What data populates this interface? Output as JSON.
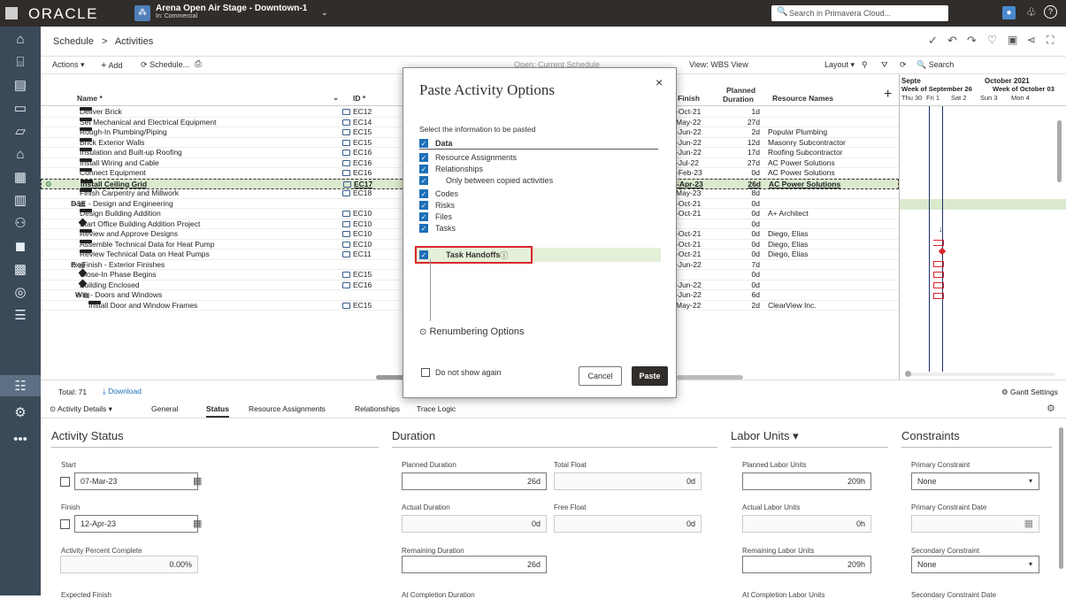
{
  "topbar": {
    "brand": "ORACLE",
    "project_name": "Arena Open Air Stage - Downtown-1",
    "project_sub": "In: Commercial",
    "search_placeholder": "Search in Primavera Cloud..."
  },
  "breadcrumb": {
    "root": "Schedule",
    "sep": ">",
    "current": "Activities"
  },
  "toolbar": {
    "actions": "Actions ▾",
    "add": "Add",
    "schedule": "Schedule...",
    "open_label": "Open: Current Schedule",
    "view": "View: WBS View",
    "layout": "Layout ▾",
    "search": "Search"
  },
  "grid": {
    "headers": {
      "name": "Name *",
      "id": "ID *",
      "finish": "Finish",
      "planned_duration_1": "Planned",
      "planned_duration_2": "Duration",
      "resources": "Resource Names"
    },
    "rows": [
      {
        "name": "Deliver Brick",
        "indent": 2,
        "type": "bar",
        "id": "EC12",
        "finish": "-Oct-21",
        "dur": "1d",
        "res": "",
        "note": true
      },
      {
        "name": "Set Mechanical and Electrical Equipment",
        "indent": 2,
        "type": "bar",
        "id": "EC14",
        "finish": "May-22",
        "dur": "27d",
        "res": "",
        "note": true
      },
      {
        "name": "Rough-In Plumbing/Piping",
        "indent": 2,
        "type": "bar",
        "id": "EC15",
        "finish": "-Jun-22",
        "dur": "2d",
        "res": "Popular Plumbing",
        "note": true
      },
      {
        "name": "Brick Exterior Walls",
        "indent": 2,
        "type": "bar",
        "id": "EC15",
        "finish": "-Jun-22",
        "dur": "12d",
        "res": "Masonry Subcontractor",
        "note": true
      },
      {
        "name": "Insulation and Built-up Roofing",
        "indent": 2,
        "type": "bar",
        "id": "EC16",
        "finish": "-Jun-22",
        "dur": "17d",
        "res": "Roofing Subcontractor",
        "note": true
      },
      {
        "name": "Install Wiring and Cable",
        "indent": 2,
        "type": "bar",
        "id": "EC16",
        "finish": "-Jul-22",
        "dur": "27d",
        "res": "AC Power Solutions",
        "note": true
      },
      {
        "name": "Connect Equipment",
        "indent": 2,
        "type": "bar",
        "id": "EC16",
        "finish": "-Feb-23",
        "dur": "0d",
        "res": "AC Power Solutions",
        "note": true
      },
      {
        "name": "Install Ceiling Grid",
        "indent": 2,
        "type": "bar",
        "id": "EC17",
        "finish": "-Apr-23",
        "dur": "26d",
        "res": "AC Power Solutions",
        "note": true,
        "highlight": true
      },
      {
        "name": "Finish Carpentry and Millwork",
        "indent": 2,
        "type": "bar",
        "id": "EC18",
        "finish": "May-23",
        "dur": "8d",
        "res": "",
        "note": true
      },
      {
        "name": "D&E - Design and Engineering",
        "indent": 1,
        "type": "wbs",
        "id": "",
        "finish": "-Oct-21",
        "dur": "0d",
        "res": "",
        "note": false
      },
      {
        "name": "Design Building Addition",
        "indent": 2,
        "type": "bar",
        "id": "EC10",
        "finish": "-Oct-21",
        "dur": "0d",
        "res": "A+ Architect",
        "note": true
      },
      {
        "name": "Start Office Building Addition Project",
        "indent": 2,
        "type": "ms",
        "id": "EC10",
        "finish": "",
        "dur": "0d",
        "res": "",
        "note": true
      },
      {
        "name": "Review and Approve Designs",
        "indent": 2,
        "type": "bar",
        "id": "EC10",
        "finish": "-Oct-21",
        "dur": "0d",
        "res": "Diego, Elias",
        "note": true
      },
      {
        "name": "Assemble Technical Data for Heat Pump",
        "indent": 2,
        "type": "bar",
        "id": "EC10",
        "finish": "-Oct-21",
        "dur": "0d",
        "res": "Diego, Elias",
        "note": true
      },
      {
        "name": "Review Technical Data on Heat Pumps",
        "indent": 2,
        "type": "bar",
        "id": "EC11",
        "finish": "-Oct-21",
        "dur": "0d",
        "res": "Diego, Elias",
        "note": true
      },
      {
        "name": "Ex-Finish - Exterior Finishes",
        "indent": 1,
        "type": "wbs",
        "id": "",
        "finish": "-Jun-22",
        "dur": "7d",
        "res": "",
        "note": false
      },
      {
        "name": "Close-In Phase Begins",
        "indent": 2,
        "type": "ms",
        "id": "EC15",
        "finish": "",
        "dur": "0d",
        "res": "",
        "note": true
      },
      {
        "name": "Building Enclosed",
        "indent": 2,
        "type": "ms",
        "id": "EC16",
        "finish": "-Jun-22",
        "dur": "0d",
        "res": "",
        "note": true
      },
      {
        "name": "Win - Doors and Windows",
        "indent": 1.5,
        "type": "wbs",
        "id": "",
        "finish": "-Jun-22",
        "dur": "6d",
        "res": "",
        "note": false
      },
      {
        "name": "Install Door and Window Frames",
        "indent": 3,
        "type": "bar",
        "id": "EC15",
        "finish": "May-22",
        "dur": "2d",
        "res": "ClearView Inc.",
        "note": true
      }
    ]
  },
  "gantt": {
    "month1": "Septe",
    "month2": "October 2021",
    "week1": "Week of September 26",
    "week2": "Week of October 03",
    "days": [
      "Thu 30",
      "Fri 1",
      "Sat 2",
      "Sun 3",
      "Mon 4"
    ]
  },
  "footer": {
    "total": "Total: 71",
    "download": "Download",
    "gantt_settings": "Gantt Settings"
  },
  "tabs": {
    "details": "Activity Details ▾",
    "items": [
      "General",
      "Status",
      "Resource Assignments",
      "Relationships",
      "Trace Logic"
    ],
    "active": "Status"
  },
  "details": {
    "activity_status": {
      "title": "Activity Status",
      "start_label": "Start",
      "start_value": "07-Mar-23",
      "finish_label": "Finish",
      "finish_value": "12-Apr-23",
      "pct_label": "Activity Percent Complete",
      "pct_value": "0.00%",
      "exp_finish_label": "Expected Finish"
    },
    "duration": {
      "title": "Duration",
      "planned_label": "Planned Duration",
      "planned_value": "26d",
      "total_float_label": "Total Float",
      "total_float_value": "0d",
      "actual_label": "Actual Duration",
      "actual_value": "0d",
      "free_float_label": "Free Float",
      "free_float_value": "0d",
      "remaining_label": "Remaining Duration",
      "remaining_value": "26d",
      "at_completion_label": "At Completion Duration"
    },
    "labor": {
      "title": "Labor Units ▾",
      "planned_label": "Planned Labor Units",
      "planned_value": "209h",
      "actual_label": "Actual Labor Units",
      "actual_value": "0h",
      "remaining_label": "Remaining Labor Units",
      "remaining_value": "209h",
      "at_completion_label": "At Completion Labor Units"
    },
    "constraints": {
      "title": "Constraints",
      "primary_label": "Primary Constraint",
      "primary_value": "None",
      "primary_date_label": "Primary Constraint Date",
      "secondary_label": "Secondary Constraint",
      "secondary_value": "None",
      "secondary_date_label": "Secondary Constraint Date"
    }
  },
  "modal": {
    "title": "Paste Activity Options",
    "instruction": "Select the information to be pasted",
    "options": [
      {
        "label": "Data",
        "bold": true
      },
      {
        "label": "Resource Assignments"
      },
      {
        "label": "Relationships"
      },
      {
        "label": "Only between copied activities",
        "sub": true
      },
      {
        "label": "Codes"
      },
      {
        "label": "Risks"
      },
      {
        "label": "Files"
      },
      {
        "label": "Tasks"
      },
      {
        "label": "Task Handoffs",
        "bold": true,
        "sub": true,
        "highlight": true
      }
    ],
    "renumbering": "Renumbering Options",
    "dont_show": "Do not show again",
    "cancel": "Cancel",
    "paste": "Paste"
  },
  "colors": {
    "topbar": "#312d2a",
    "sidebar": "#3b4a59",
    "accent": "#1e6fb8",
    "highlight_row": "#dbe9cf",
    "handoff_box": "#d9262c",
    "gantt_line": "#1c2f6b",
    "gantt_red": "#d9262c"
  }
}
